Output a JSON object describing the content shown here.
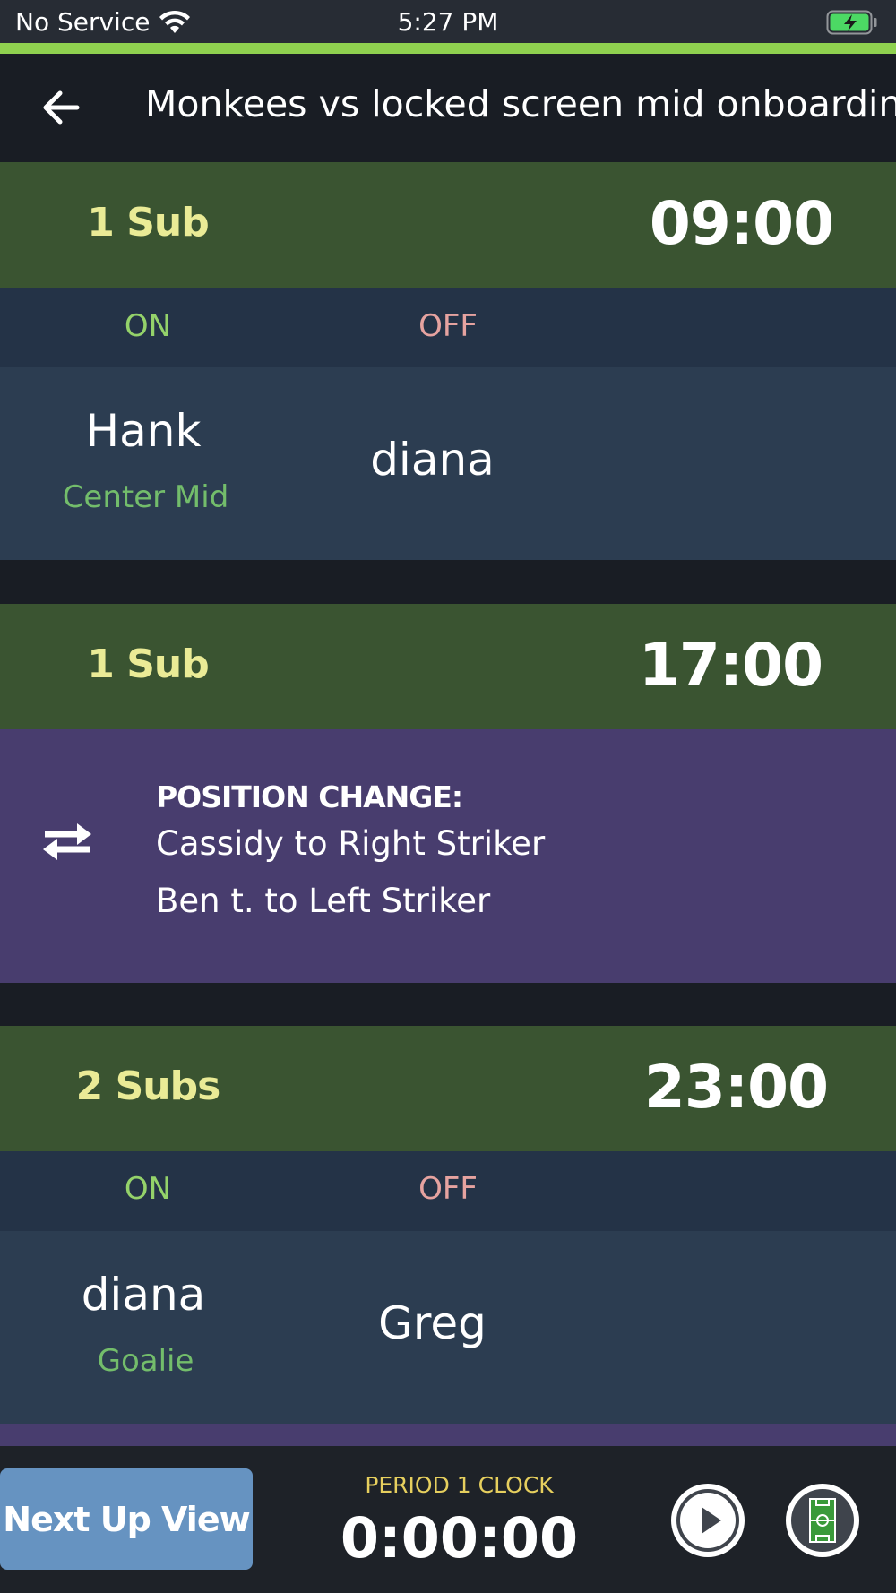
{
  "status_bar": {
    "carrier": "No Service",
    "time": "5:27 PM"
  },
  "nav": {
    "title": "Monkees vs locked screen mid onboarding"
  },
  "sub_events": [
    {
      "count": "1 Sub",
      "time": "09:00",
      "on_label": "ON",
      "off_label": "OFF",
      "on_player": "Hank",
      "on_position": "Center Mid",
      "off_player": "diana"
    },
    {
      "count": "1 Sub",
      "time": "17:00",
      "position_change_title": "POSITION CHANGE:",
      "changes": [
        "Cassidy   to Right Striker",
        "Ben  t. to Left Striker"
      ]
    },
    {
      "count": "2 Subs",
      "time": "23:00",
      "on_label": "ON",
      "off_label": "OFF",
      "on_player": "diana",
      "on_position": "Goalie",
      "off_player": "Greg"
    }
  ],
  "bottom_bar": {
    "next_up_label": "Next Up View",
    "period_label": "PERIOD 1 CLOCK",
    "clock": "0:00:00"
  },
  "colors": {
    "accent_green": "#8fd14f",
    "sub_header": "#3a5431",
    "position_change_bg": "#483d6e",
    "next_up_button": "#6693c1"
  }
}
